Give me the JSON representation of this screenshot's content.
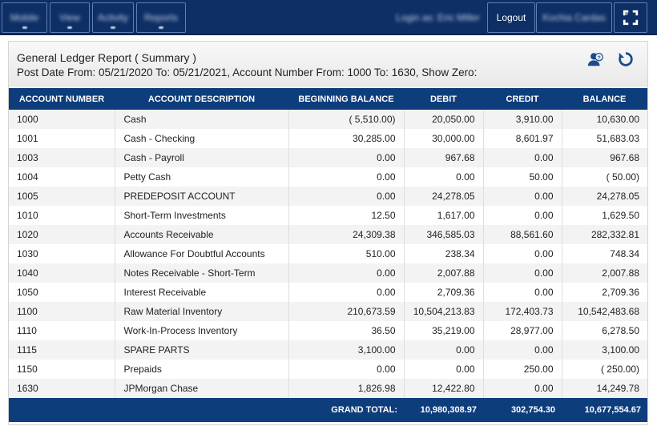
{
  "nav": {
    "items": [
      {
        "label": "Mobile",
        "icon": "chevron-down-icon"
      },
      {
        "label": "View",
        "icon": "chevron-down-icon"
      },
      {
        "label": "Activity",
        "icon": "chevron-down-icon"
      },
      {
        "label": "Reports",
        "icon": "chevron-down-icon"
      }
    ],
    "user_label": "Login as: Eric Miller",
    "logout_label": "Logout",
    "company_label": "Kochia Cardas",
    "fullscreen_icon": "expand-icon"
  },
  "report": {
    "title": "General Ledger Report ( Summary )",
    "subtitle": "Post Date From: 05/21/2020 To: 05/21/2021, Account Number From: 1000 To: 1630, Show Zero:",
    "icons": [
      "user-help-icon",
      "refresh-icon"
    ]
  },
  "table": {
    "columns": [
      "ACCOUNT NUMBER",
      "ACCOUNT DESCRIPTION",
      "BEGINNING BALANCE",
      "DEBIT",
      "CREDIT",
      "BALANCE"
    ],
    "rows": [
      [
        "1000",
        "Cash",
        "( 5,510.00)",
        "20,050.00",
        "3,910.00",
        "10,630.00"
      ],
      [
        "1001",
        "Cash - Checking",
        "30,285.00",
        "30,000.00",
        "8,601.97",
        "51,683.03"
      ],
      [
        "1003",
        "Cash - Payroll",
        "0.00",
        "967.68",
        "0.00",
        "967.68"
      ],
      [
        "1004",
        "Petty Cash",
        "0.00",
        "0.00",
        "50.00",
        "( 50.00)"
      ],
      [
        "1005",
        "PREDEPOSIT ACCOUNT",
        "0.00",
        "24,278.05",
        "0.00",
        "24,278.05"
      ],
      [
        "1010",
        "Short-Term Investments",
        "12.50",
        "1,617.00",
        "0.00",
        "1,629.50"
      ],
      [
        "1020",
        "Accounts Receivable",
        "24,309.38",
        "346,585.03",
        "88,561.60",
        "282,332.81"
      ],
      [
        "1030",
        "Allowance For Doubtful Accounts",
        "510.00",
        "238.34",
        "0.00",
        "748.34"
      ],
      [
        "1040",
        "Notes Receivable - Short-Term",
        "0.00",
        "2,007.88",
        "0.00",
        "2,007.88"
      ],
      [
        "1050",
        "Interest Receivable",
        "0.00",
        "2,709.36",
        "0.00",
        "2,709.36"
      ],
      [
        "1100",
        "Raw Material Inventory",
        "210,673.59",
        "10,504,213.83",
        "172,403.73",
        "10,542,483.68"
      ],
      [
        "1110",
        "Work-In-Process Inventory",
        "36.50",
        "35,219.00",
        "28,977.00",
        "6,278.50"
      ],
      [
        "1115",
        "SPARE PARTS",
        "3,100.00",
        "0.00",
        "0.00",
        "3,100.00"
      ],
      [
        "1150",
        "Prepaids",
        "0.00",
        "0.00",
        "250.00",
        "( 250.00)"
      ],
      [
        "1630",
        "JPMorgan Chase",
        "1,826.98",
        "12,422.80",
        "0.00",
        "14,249.78"
      ]
    ],
    "total": {
      "label": "GRAND TOTAL:",
      "debit": "10,980,308.97",
      "credit": "302,754.30",
      "balance": "10,677,554.67"
    }
  },
  "colors": {
    "navbar": "#0e2f66",
    "table_header": "#0e3d7c",
    "accent_icon": "#1b4a8a"
  }
}
